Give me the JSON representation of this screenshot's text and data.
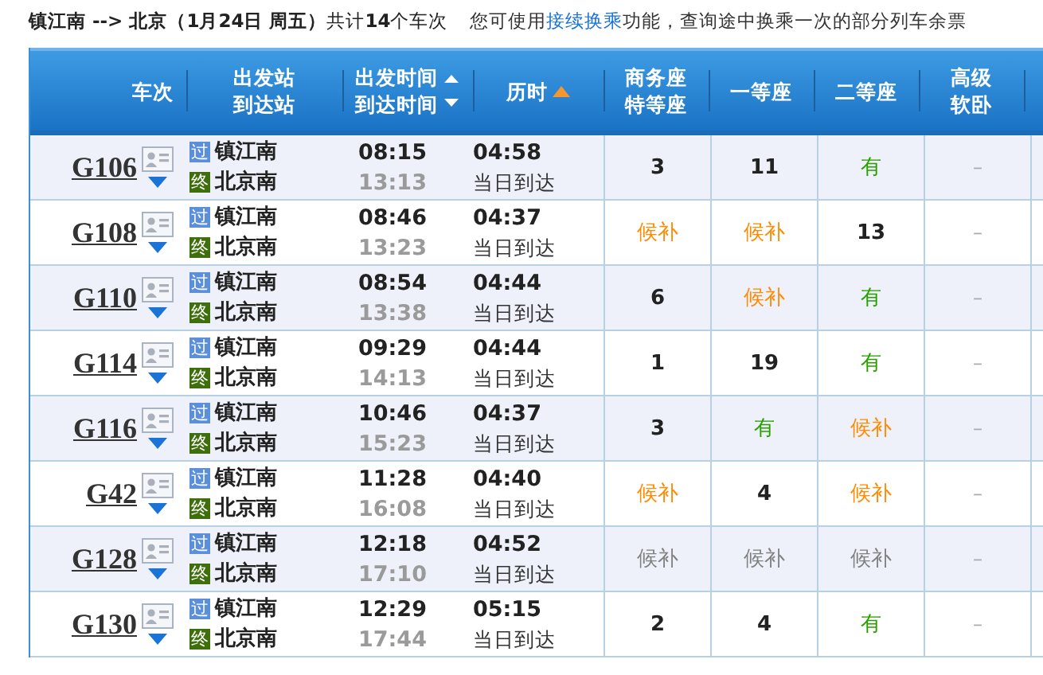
{
  "summary": "**镇江南 --> 北京（1月24日  周五）**共计**14**个车次",
  "notice": {
    "before": "您可使用",
    "link": "接续换乘",
    "after": "功能，查询途中换乘一次的部分列车余票"
  },
  "columns": [
    {
      "lines": [
        "车次"
      ],
      "kind": "plain"
    },
    {
      "lines": [
        "出发站",
        "到达站"
      ],
      "kind": "plain"
    },
    {
      "lines": [
        "出发时间",
        "到达时间"
      ],
      "kind": "sortboth"
    },
    {
      "lines": [
        "历时"
      ],
      "kind": "sortasc"
    },
    {
      "lines": [
        "商务座",
        "特等座"
      ],
      "kind": "plain"
    },
    {
      "lines": [
        "一等座"
      ],
      "kind": "plain"
    },
    {
      "lines": [
        "二等座"
      ],
      "kind": "plain"
    },
    {
      "lines": [
        "高级",
        "软卧"
      ],
      "kind": "plain"
    }
  ],
  "rows": [
    {
      "train": "G106",
      "from_badge": "过",
      "from": "镇江南",
      "to_badge": "终",
      "to": "北京南",
      "depart": "08:15",
      "arrive": "13:13",
      "duration": "04:58",
      "arrival_day": "当日到达",
      "seats": [
        {
          "text": "3",
          "kind": "count"
        },
        {
          "text": "11",
          "kind": "count"
        },
        {
          "text": "有",
          "kind": "available"
        },
        {
          "text": "–",
          "kind": "none"
        }
      ]
    },
    {
      "train": "G108",
      "from_badge": "过",
      "from": "镇江南",
      "to_badge": "终",
      "to": "北京南",
      "depart": "08:46",
      "arrive": "13:23",
      "duration": "04:37",
      "arrival_day": "当日到达",
      "seats": [
        {
          "text": "候补",
          "kind": "waitlist"
        },
        {
          "text": "候补",
          "kind": "waitlist"
        },
        {
          "text": "13",
          "kind": "count"
        },
        {
          "text": "–",
          "kind": "none"
        }
      ]
    },
    {
      "train": "G110",
      "from_badge": "过",
      "from": "镇江南",
      "to_badge": "终",
      "to": "北京南",
      "depart": "08:54",
      "arrive": "13:38",
      "duration": "04:44",
      "arrival_day": "当日到达",
      "seats": [
        {
          "text": "6",
          "kind": "count"
        },
        {
          "text": "候补",
          "kind": "waitlist"
        },
        {
          "text": "有",
          "kind": "available"
        },
        {
          "text": "–",
          "kind": "none"
        }
      ]
    },
    {
      "train": "G114",
      "from_badge": "过",
      "from": "镇江南",
      "to_badge": "终",
      "to": "北京南",
      "depart": "09:29",
      "arrive": "14:13",
      "duration": "04:44",
      "arrival_day": "当日到达",
      "seats": [
        {
          "text": "1",
          "kind": "count"
        },
        {
          "text": "19",
          "kind": "count"
        },
        {
          "text": "有",
          "kind": "available"
        },
        {
          "text": "–",
          "kind": "none"
        }
      ]
    },
    {
      "train": "G116",
      "from_badge": "过",
      "from": "镇江南",
      "to_badge": "终",
      "to": "北京南",
      "depart": "10:46",
      "arrive": "15:23",
      "duration": "04:37",
      "arrival_day": "当日到达",
      "seats": [
        {
          "text": "3",
          "kind": "count"
        },
        {
          "text": "有",
          "kind": "available"
        },
        {
          "text": "候补",
          "kind": "waitlist"
        },
        {
          "text": "–",
          "kind": "none"
        }
      ]
    },
    {
      "train": "G42",
      "from_badge": "过",
      "from": "镇江南",
      "to_badge": "终",
      "to": "北京南",
      "depart": "11:28",
      "arrive": "16:08",
      "duration": "04:40",
      "arrival_day": "当日到达",
      "seats": [
        {
          "text": "候补",
          "kind": "waitlist"
        },
        {
          "text": "4",
          "kind": "count"
        },
        {
          "text": "候补",
          "kind": "waitlist"
        },
        {
          "text": "–",
          "kind": "none"
        }
      ]
    },
    {
      "train": "G128",
      "from_badge": "过",
      "from": "镇江南",
      "to_badge": "终",
      "to": "北京南",
      "depart": "12:18",
      "arrive": "17:10",
      "duration": "04:52",
      "arrival_day": "当日到达",
      "seats": [
        {
          "text": "候补",
          "kind": "waitlist_closed"
        },
        {
          "text": "候补",
          "kind": "waitlist_closed"
        },
        {
          "text": "候补",
          "kind": "waitlist_closed"
        },
        {
          "text": "–",
          "kind": "none"
        }
      ]
    },
    {
      "train": "G130",
      "from_badge": "过",
      "from": "镇江南",
      "to_badge": "终",
      "to": "北京南",
      "depart": "12:29",
      "arrive": "17:44",
      "duration": "05:15",
      "arrival_day": "当日到达",
      "seats": [
        {
          "text": "2",
          "kind": "count"
        },
        {
          "text": "4",
          "kind": "count"
        },
        {
          "text": "有",
          "kind": "available"
        },
        {
          "text": "–",
          "kind": "none"
        }
      ]
    }
  ]
}
